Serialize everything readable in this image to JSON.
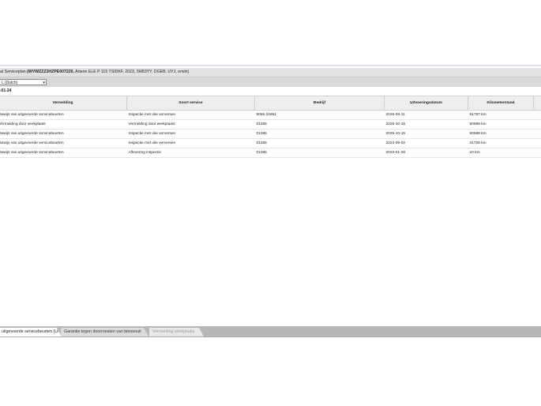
{
  "window": {
    "title_prefix": "al Serviceplan ",
    "title_bold": "(WVWZZZ3HZPE007220,",
    "title_rest": " Arteon ELE P 115 TSIDKF, 2023, 3HB3YY, DGEB, UYJ, erwin)"
  },
  "language_select": {
    "value": "L (Dutch)"
  },
  "date_caption": "-01-24",
  "table": {
    "headers": [
      "Vermelding",
      "Soort service",
      "Bedrijf",
      "Uitvoeringsdatum",
      "Kilometerstand"
    ],
    "rows": [
      [
        "Bewijs van uitgevoerde servicebeurten",
        "Inspectie met olie verversen",
        "9055 24661",
        "2026-08-11",
        "61797 km"
      ],
      [
        "Vermelding door werkplaats",
        "Vermelding door werkplaats",
        "01265",
        "2025-10-15",
        "50588 km"
      ],
      [
        "Bewijs van uitgevoerde servicebeurten",
        "Inspectie met olie verversen",
        "01265",
        "2025-10-15",
        "50588 km"
      ],
      [
        "Bewijs van uitgevoerde servicebeurten",
        "Inspectie met olie verversen",
        "01265",
        "2024-09-02",
        "31728 km"
      ],
      [
        "Bewijs van uitgevoerde servicebeurten",
        "Aflevering inspectie",
        "01265",
        "2023-01-28",
        "10 km"
      ]
    ]
  },
  "tabs": [
    {
      "label": "uitgevoerde servicebeurten (LH)",
      "state": "active"
    },
    {
      "label": "Garantie tegen doorroesten van binnenuit",
      "state": "inactive"
    },
    {
      "label": "Vermelding werkplaats",
      "state": "disabled"
    }
  ]
}
